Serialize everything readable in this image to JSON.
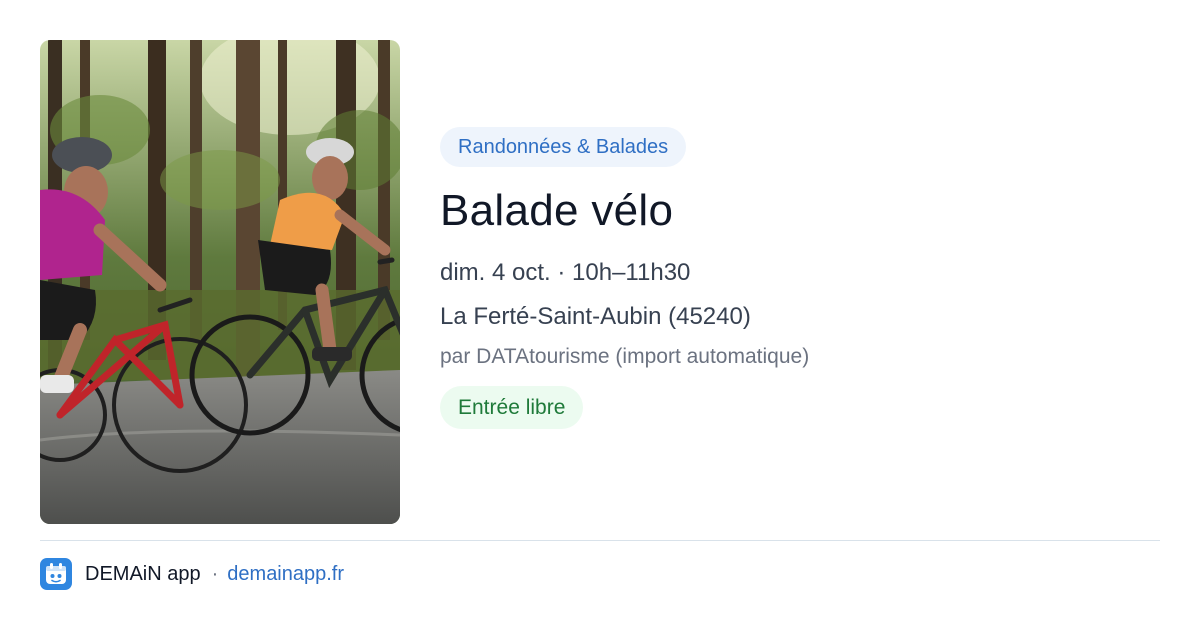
{
  "event": {
    "category": "Randonnées & Balades",
    "title": "Balade vélo",
    "date_time": "dim. 4 oct. · 10h–11h30",
    "location": "La Ferté-Saint-Aubin (45240)",
    "organizer": "par DATAtourisme (import automatique)",
    "price": "Entrée libre",
    "image": "cyclists-in-forest-photo"
  },
  "footer": {
    "app_name": "DEMAiN app",
    "separator": "·",
    "link": "demainapp.fr",
    "logo_icon": "demain-app-logo-icon"
  },
  "colors": {
    "accent_blue": "#2f6fc4",
    "badge_blue_bg": "#eef4fc",
    "free_green": "#1f7a3a",
    "badge_green_bg": "#ecfbf0",
    "logo_bg": "#2f86e0"
  }
}
